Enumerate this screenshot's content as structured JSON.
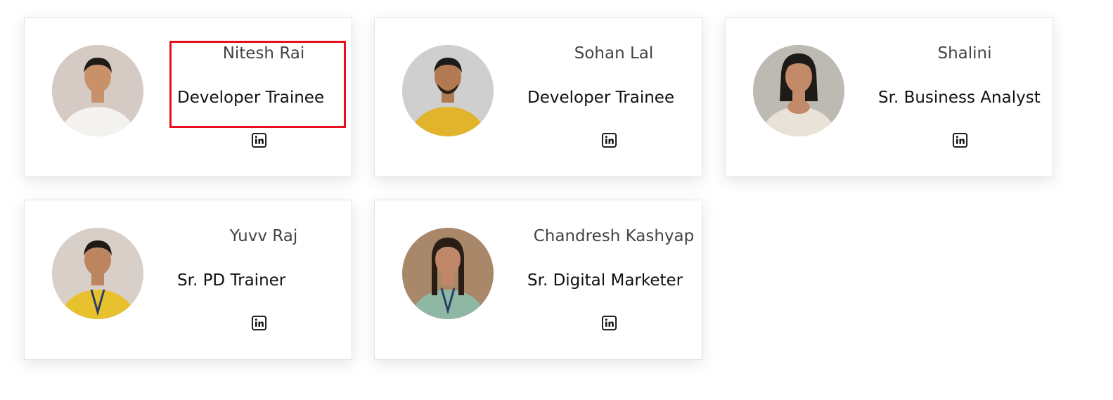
{
  "team": [
    {
      "name": "Nitesh Rai",
      "role": "Developer Trainee",
      "shirt": "#f4f2ee",
      "skin": "#c9916a",
      "bg": "#d6cbc4",
      "highlighted": true
    },
    {
      "name": "Sohan Lal",
      "role": "Developer Trainee",
      "shirt": "#e2b42c",
      "skin": "#b27a52",
      "bg": "#cfcfcf",
      "highlighted": false
    },
    {
      "name": "Shalini",
      "role": "Sr. Business Analyst",
      "shirt": "#e8e2d8",
      "skin": "#c28a68",
      "bg": "#bdbab3",
      "highlighted": false
    },
    {
      "name": "Yuvv Raj",
      "role": "Sr. PD Trainer",
      "shirt": "#e7c12e",
      "skin": "#bd8460",
      "bg": "#d8cfc8",
      "highlighted": false
    },
    {
      "name": "Chandresh Kashyap",
      "role": "Sr. Digital Marketer",
      "shirt": "#8fb8a4",
      "skin": "#c08868",
      "bg": "#a9886a",
      "highlighted": false
    }
  ],
  "social_icon": "linkedin-icon",
  "colors": {
    "highlight": "#e8101e",
    "card_border": "#e3e3e3"
  }
}
